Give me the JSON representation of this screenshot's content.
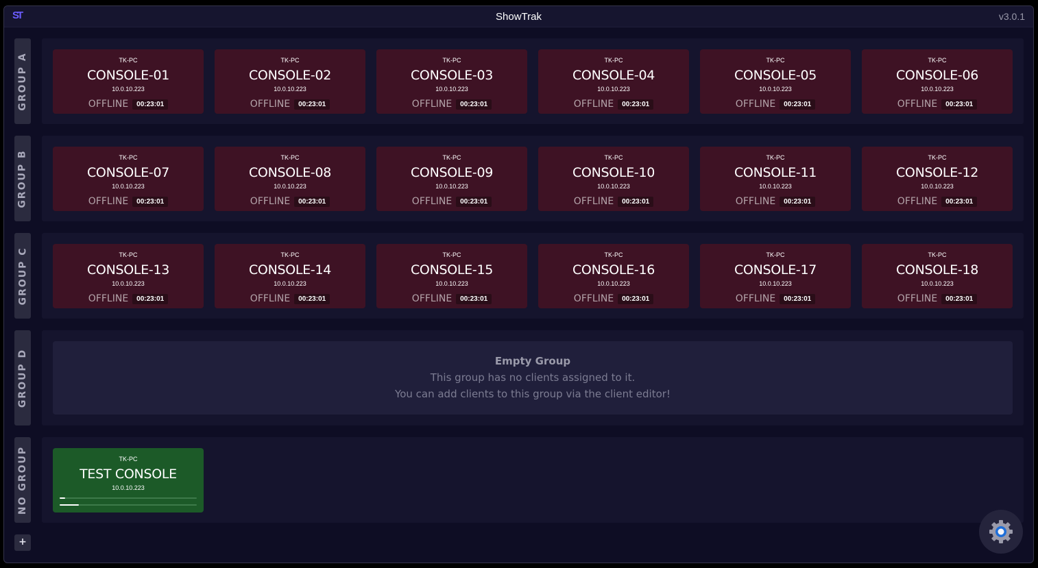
{
  "app": {
    "logo_text": "ST",
    "title": "ShowTrak",
    "version": "v3.0.1"
  },
  "groups": [
    {
      "name": "GROUP A",
      "clients": [
        {
          "host": "TK-PC",
          "name": "CONSOLE-01",
          "ip": "10.0.10.223",
          "status": "OFFLINE",
          "time": "00:23:01"
        },
        {
          "host": "TK-PC",
          "name": "CONSOLE-02",
          "ip": "10.0.10.223",
          "status": "OFFLINE",
          "time": "00:23:01"
        },
        {
          "host": "TK-PC",
          "name": "CONSOLE-03",
          "ip": "10.0.10.223",
          "status": "OFFLINE",
          "time": "00:23:01"
        },
        {
          "host": "TK-PC",
          "name": "CONSOLE-04",
          "ip": "10.0.10.223",
          "status": "OFFLINE",
          "time": "00:23:01"
        },
        {
          "host": "TK-PC",
          "name": "CONSOLE-05",
          "ip": "10.0.10.223",
          "status": "OFFLINE",
          "time": "00:23:01"
        },
        {
          "host": "TK-PC",
          "name": "CONSOLE-06",
          "ip": "10.0.10.223",
          "status": "OFFLINE",
          "time": "00:23:01"
        }
      ]
    },
    {
      "name": "GROUP B",
      "clients": [
        {
          "host": "TK-PC",
          "name": "CONSOLE-07",
          "ip": "10.0.10.223",
          "status": "OFFLINE",
          "time": "00:23:01"
        },
        {
          "host": "TK-PC",
          "name": "CONSOLE-08",
          "ip": "10.0.10.223",
          "status": "OFFLINE",
          "time": "00:23:01"
        },
        {
          "host": "TK-PC",
          "name": "CONSOLE-09",
          "ip": "10.0.10.223",
          "status": "OFFLINE",
          "time": "00:23:01"
        },
        {
          "host": "TK-PC",
          "name": "CONSOLE-10",
          "ip": "10.0.10.223",
          "status": "OFFLINE",
          "time": "00:23:01"
        },
        {
          "host": "TK-PC",
          "name": "CONSOLE-11",
          "ip": "10.0.10.223",
          "status": "OFFLINE",
          "time": "00:23:01"
        },
        {
          "host": "TK-PC",
          "name": "CONSOLE-12",
          "ip": "10.0.10.223",
          "status": "OFFLINE",
          "time": "00:23:01"
        }
      ]
    },
    {
      "name": "GROUP C",
      "clients": [
        {
          "host": "TK-PC",
          "name": "CONSOLE-13",
          "ip": "10.0.10.223",
          "status": "OFFLINE",
          "time": "00:23:01"
        },
        {
          "host": "TK-PC",
          "name": "CONSOLE-14",
          "ip": "10.0.10.223",
          "status": "OFFLINE",
          "time": "00:23:01"
        },
        {
          "host": "TK-PC",
          "name": "CONSOLE-15",
          "ip": "10.0.10.223",
          "status": "OFFLINE",
          "time": "00:23:01"
        },
        {
          "host": "TK-PC",
          "name": "CONSOLE-16",
          "ip": "10.0.10.223",
          "status": "OFFLINE",
          "time": "00:23:01"
        },
        {
          "host": "TK-PC",
          "name": "CONSOLE-17",
          "ip": "10.0.10.223",
          "status": "OFFLINE",
          "time": "00:23:01"
        },
        {
          "host": "TK-PC",
          "name": "CONSOLE-18",
          "ip": "10.0.10.223",
          "status": "OFFLINE",
          "time": "00:23:01"
        }
      ]
    },
    {
      "name": "GROUP D",
      "empty": {
        "title": "Empty Group",
        "line1": "This group has no clients assigned to it.",
        "line2": "You can add clients to this group via the client editor!"
      }
    },
    {
      "name": "NO GROUP",
      "test_client": {
        "host": "TK-PC",
        "name": "TEST CONSOLE",
        "ip": "10.0.10.223",
        "bar1_level": 0.04,
        "bar2_level": 0.14
      }
    }
  ],
  "add_group_label": "+",
  "icons": {
    "settings": "gear-icon"
  },
  "colors": {
    "offline_card": "#3e1224",
    "online_card": "#1c5a28",
    "settings_accent": "#1e6ed8"
  }
}
